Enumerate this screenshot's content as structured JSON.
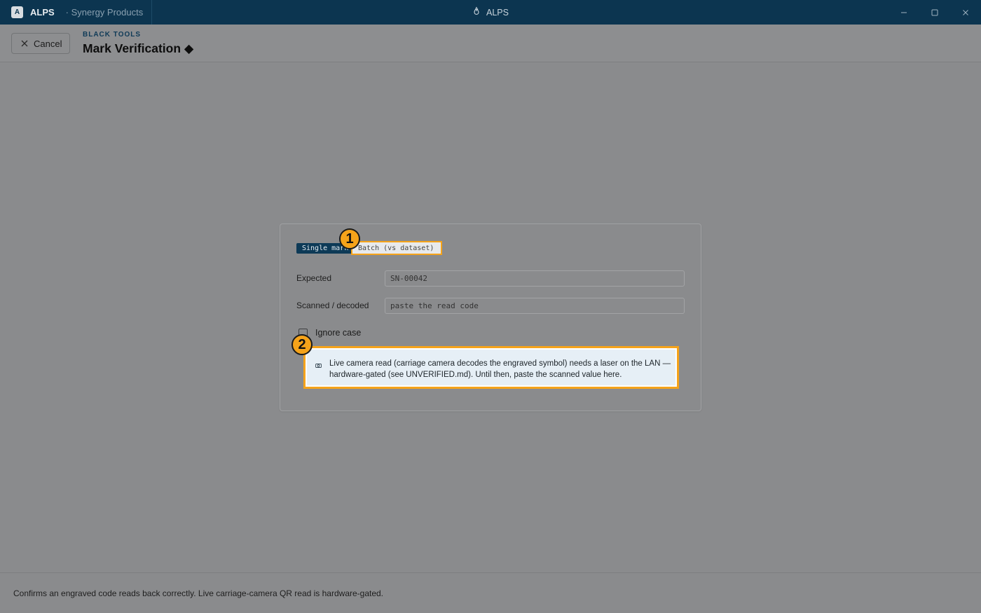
{
  "titlebar": {
    "app_badge": "A",
    "app_name": "ALPS",
    "org_name": "· Synergy Products",
    "window_title": "ALPS"
  },
  "header": {
    "cancel_label": "Cancel",
    "breadcrumb": "BLACK TOOLS",
    "title": "Mark Verification ◆"
  },
  "mode_tabs": {
    "single_label": "Single mark",
    "batch_label": "Batch (vs dataset)",
    "active": "single"
  },
  "fields": {
    "expected_label": "Expected",
    "expected_value": "SN-00042",
    "scanned_label": "Scanned / decoded",
    "scanned_placeholder": "paste the read code"
  },
  "options": {
    "ignore_case_label": "Ignore case",
    "ignore_case_checked": false
  },
  "notice": {
    "icon": "camera-icon",
    "text": "Live camera read (carriage camera decodes the engraved symbol) needs a laser on the LAN — hardware-gated (see UNVERIFIED.md). Until then, paste the scanned value here."
  },
  "markers": {
    "one": "1",
    "two": "2"
  },
  "footer": {
    "text": "Confirms an engraved code reads back correctly. Live carriage-camera QR read is hardware-gated."
  },
  "colors": {
    "titlebar_bg": "#0c3550",
    "accent": "#0d3a57",
    "highlight": "#f5a31a",
    "notice_bg": "#e6eff6"
  }
}
